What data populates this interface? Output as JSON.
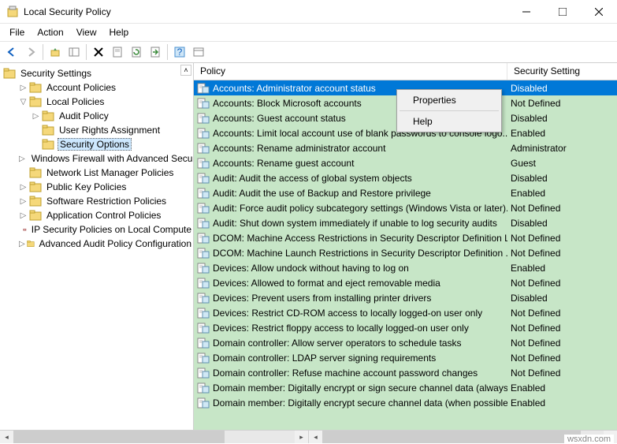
{
  "window": {
    "title": "Local Security Policy"
  },
  "menubar": [
    "File",
    "Action",
    "View",
    "Help"
  ],
  "tree": {
    "root": "Security Settings",
    "nodes": [
      {
        "label": "Account Policies",
        "depth": 1,
        "exp": "▷"
      },
      {
        "label": "Local Policies",
        "depth": 1,
        "exp": "▽"
      },
      {
        "label": "Audit Policy",
        "depth": 2,
        "exp": "▷"
      },
      {
        "label": "User Rights Assignment",
        "depth": 2,
        "exp": ""
      },
      {
        "label": "Security Options",
        "depth": 2,
        "exp": "",
        "selected": true
      },
      {
        "label": "Windows Firewall with Advanced Secu",
        "depth": 1,
        "exp": "▷"
      },
      {
        "label": "Network List Manager Policies",
        "depth": 1,
        "exp": ""
      },
      {
        "label": "Public Key Policies",
        "depth": 1,
        "exp": "▷"
      },
      {
        "label": "Software Restriction Policies",
        "depth": 1,
        "exp": "▷"
      },
      {
        "label": "Application Control Policies",
        "depth": 1,
        "exp": "▷"
      },
      {
        "label": "IP Security Policies on Local Compute",
        "depth": 1,
        "exp": "",
        "icon": "ip"
      },
      {
        "label": "Advanced Audit Policy Configuration",
        "depth": 1,
        "exp": "▷"
      }
    ]
  },
  "list": {
    "headers": {
      "policy": "Policy",
      "setting": "Security Setting"
    },
    "rows": [
      {
        "policy": "Accounts: Administrator account status",
        "setting": "Disabled",
        "selected": true
      },
      {
        "policy": "Accounts: Block Microsoft accounts",
        "setting": "Not Defined"
      },
      {
        "policy": "Accounts: Guest account status",
        "setting": "Disabled"
      },
      {
        "policy": "Accounts: Limit local account use of blank passwords to console logo...",
        "setting": "Enabled"
      },
      {
        "policy": "Accounts: Rename administrator account",
        "setting": "Administrator"
      },
      {
        "policy": "Accounts: Rename guest account",
        "setting": "Guest"
      },
      {
        "policy": "Audit: Audit the access of global system objects",
        "setting": "Disabled"
      },
      {
        "policy": "Audit: Audit the use of Backup and Restore privilege",
        "setting": "Enabled"
      },
      {
        "policy": "Audit: Force audit policy subcategory settings (Windows Vista or later)...",
        "setting": "Not Defined"
      },
      {
        "policy": "Audit: Shut down system immediately if unable to log security audits",
        "setting": "Disabled"
      },
      {
        "policy": "DCOM: Machine Access Restrictions in Security Descriptor Definition L...",
        "setting": "Not Defined"
      },
      {
        "policy": "DCOM: Machine Launch Restrictions in Security Descriptor Definition ...",
        "setting": "Not Defined"
      },
      {
        "policy": "Devices: Allow undock without having to log on",
        "setting": "Enabled"
      },
      {
        "policy": "Devices: Allowed to format and eject removable media",
        "setting": "Not Defined"
      },
      {
        "policy": "Devices: Prevent users from installing printer drivers",
        "setting": "Disabled"
      },
      {
        "policy": "Devices: Restrict CD-ROM access to locally logged-on user only",
        "setting": "Not Defined"
      },
      {
        "policy": "Devices: Restrict floppy access to locally logged-on user only",
        "setting": "Not Defined"
      },
      {
        "policy": "Domain controller: Allow server operators to schedule tasks",
        "setting": "Not Defined"
      },
      {
        "policy": "Domain controller: LDAP server signing requirements",
        "setting": "Not Defined"
      },
      {
        "policy": "Domain controller: Refuse machine account password changes",
        "setting": "Not Defined"
      },
      {
        "policy": "Domain member: Digitally encrypt or sign secure channel data (always)",
        "setting": "Enabled"
      },
      {
        "policy": "Domain member: Digitally encrypt secure channel data (when possible)",
        "setting": "Enabled"
      }
    ]
  },
  "context_menu": {
    "items": [
      "Properties",
      "Help"
    ]
  },
  "watermark": "wsxdn.com"
}
